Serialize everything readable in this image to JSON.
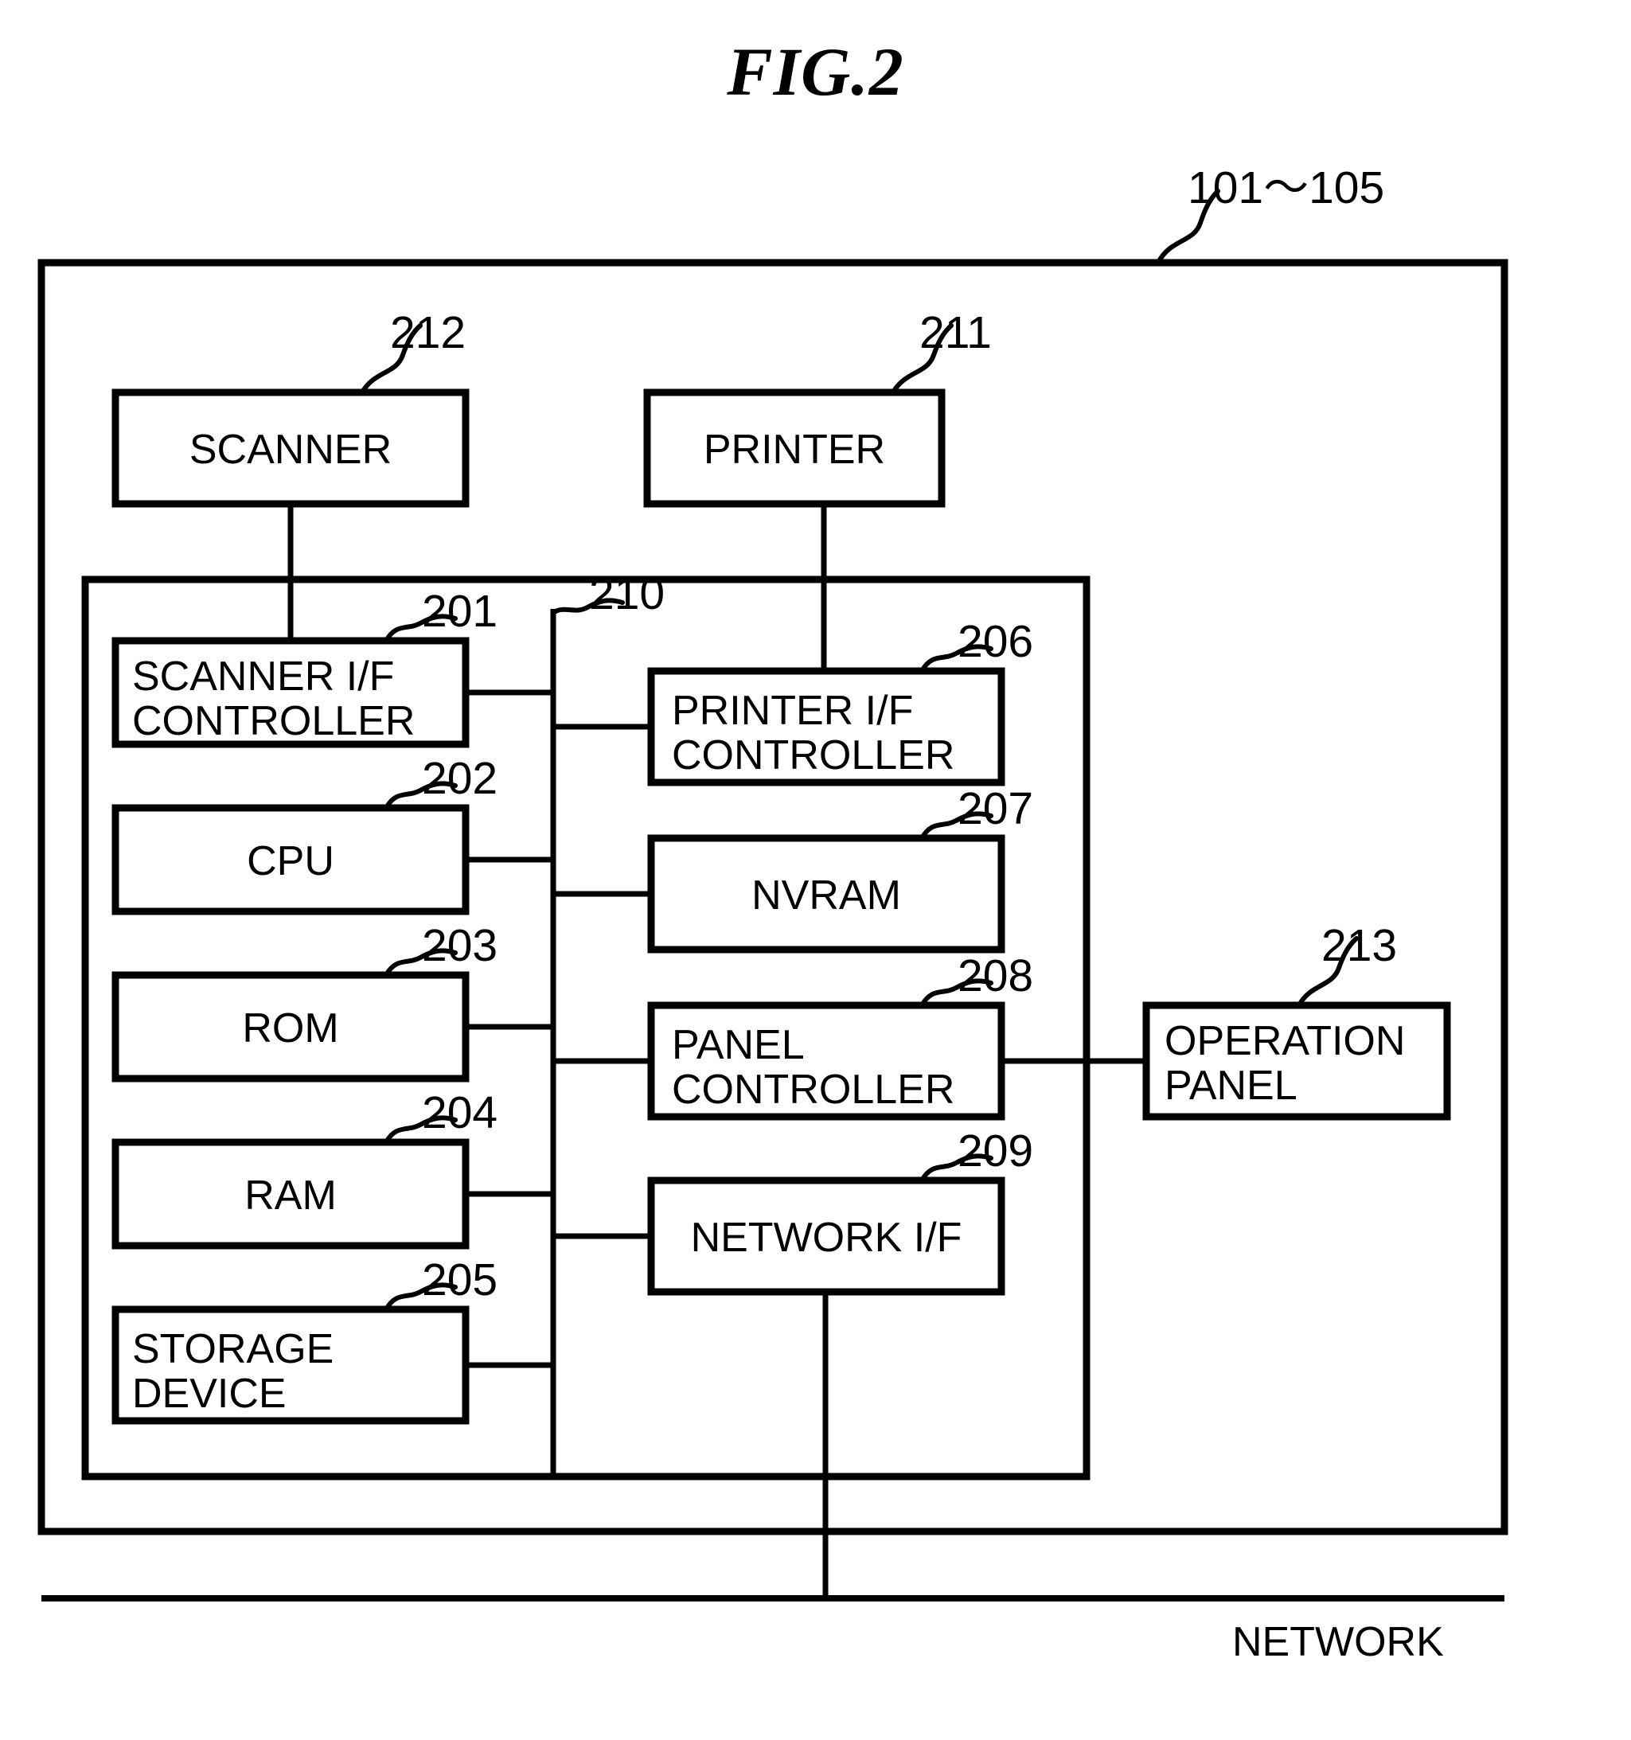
{
  "figure": {
    "title": "FIG.2",
    "device_ref": "101〜105",
    "network_label": "NETWORK"
  },
  "external_devices": [
    {
      "id": "scanner",
      "label": "SCANNER",
      "ref": "212"
    },
    {
      "id": "printer",
      "label": "PRINTER",
      "ref": "211"
    },
    {
      "id": "operation-panel",
      "label": "OPERATION\nPANEL",
      "ref": "213"
    }
  ],
  "controller": {
    "bus_ref": "210",
    "left_column": [
      {
        "id": "scanner-if-controller",
        "label": "SCANNER I/F\nCONTROLLER",
        "ref": "201",
        "align": "left"
      },
      {
        "id": "cpu",
        "label": "CPU",
        "ref": "202",
        "align": "center"
      },
      {
        "id": "rom",
        "label": "ROM",
        "ref": "203",
        "align": "center"
      },
      {
        "id": "ram",
        "label": "RAM",
        "ref": "204",
        "align": "center"
      },
      {
        "id": "storage-device",
        "label": "STORAGE\nDEVICE",
        "ref": "205",
        "align": "left"
      }
    ],
    "right_column": [
      {
        "id": "printer-if-controller",
        "label": "PRINTER I/F\nCONTROLLER",
        "ref": "206",
        "align": "left"
      },
      {
        "id": "nvram",
        "label": "NVRAM",
        "ref": "207",
        "align": "center"
      },
      {
        "id": "panel-controller",
        "label": "PANEL\nCONTROLLER",
        "ref": "208",
        "align": "left"
      },
      {
        "id": "network-if",
        "label": "NETWORK I/F",
        "ref": "209",
        "align": "center"
      }
    ]
  },
  "colors": {
    "line": "#000000",
    "background": "#ffffff"
  }
}
